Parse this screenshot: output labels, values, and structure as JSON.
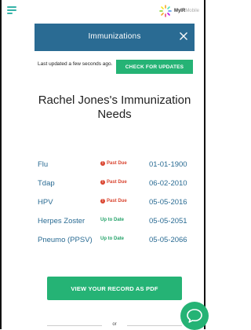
{
  "brand": {
    "name_bold": "MyIR",
    "name_light": "Mobile"
  },
  "modal": {
    "title": "Immunizations"
  },
  "update": {
    "status_text": "Last updated a few seconds ago.",
    "check_button": "CHECK FOR UPDATES"
  },
  "page": {
    "title": "Rachel Jones's Immunization Needs"
  },
  "immunizations": [
    {
      "name": "Flu",
      "status": "Past Due",
      "status_type": "past-due",
      "date": "01-01-1900"
    },
    {
      "name": "Tdap",
      "status": "Past Due",
      "status_type": "past-due",
      "date": "06-02-2010"
    },
    {
      "name": "HPV",
      "status": "Past Due",
      "status_type": "past-due",
      "date": "05-05-2016"
    },
    {
      "name": "Herpes Zoster",
      "status": "Up to Date",
      "status_type": "up-to-date",
      "date": "05-05-2051"
    },
    {
      "name": "Pneumo (PPSV)",
      "status": "Up to Date",
      "status_type": "up-to-date",
      "date": "05-05-2066"
    }
  ],
  "actions": {
    "pdf_button": "VIEW YOUR RECORD AS PDF",
    "divider_text": "or"
  },
  "colors": {
    "header": "#2a6b93",
    "accent_green": "#25b375",
    "past_due": "#d9442f",
    "up_to_date": "#25a36a",
    "link_blue": "#2a6b93"
  },
  "icons": {
    "menu": "hamburger-menu-icon",
    "logo": "sun-logo-icon",
    "close": "close-icon",
    "past_due": "exclamation-circle-icon",
    "chat": "chat-bubble-icon"
  }
}
